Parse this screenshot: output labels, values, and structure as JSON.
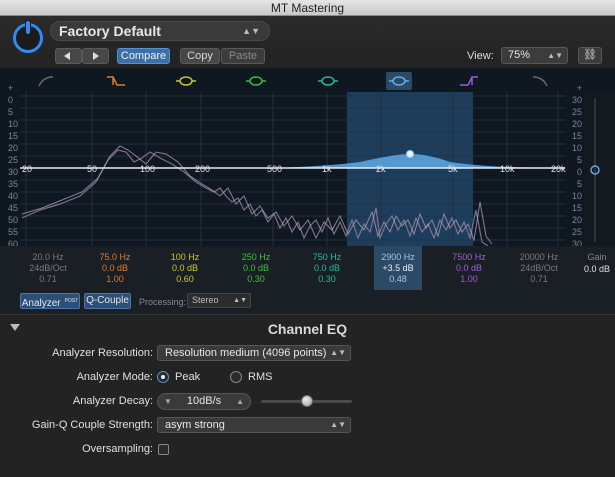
{
  "window": {
    "title": "MT Mastering"
  },
  "header": {
    "preset_name": "Factory Default",
    "compare_label": "Compare",
    "copy_label": "Copy",
    "paste_label": "Paste",
    "view_label": "View:",
    "view_value": "75%"
  },
  "graph": {
    "db_scale_left": [
      "+",
      "0",
      "5",
      "10",
      "15",
      "20",
      "25",
      "30",
      "35",
      "40",
      "45",
      "50",
      "55",
      "60",
      "-"
    ],
    "db_scale_right": [
      "+",
      "30",
      "25",
      "20",
      "15",
      "10",
      "5",
      "0",
      "5",
      "10",
      "15",
      "20",
      "25",
      "30",
      "-"
    ],
    "freq_labels": [
      "20",
      "50",
      "100",
      "200",
      "500",
      "1k",
      "2k",
      "5k",
      "10k",
      "20k"
    ],
    "gain_label": "Gain",
    "gain_value": "0.0 dB"
  },
  "bands": [
    {
      "freq": "20.0 Hz",
      "gain": "24dB/Oct",
      "q": "0.71",
      "color": "#7a7a7a"
    },
    {
      "freq": "75.0 Hz",
      "gain": "0.0 dB",
      "q": "1.00",
      "color": "#e07a2a"
    },
    {
      "freq": "100 Hz",
      "gain": "0.0 dB",
      "q": "0.60",
      "color": "#c9c92a"
    },
    {
      "freq": "250 Hz",
      "gain": "0.0 dB",
      "q": "0.30",
      "color": "#3fbf3f"
    },
    {
      "freq": "750 Hz",
      "gain": "0.0 dB",
      "q": "0.30",
      "color": "#2ab89e"
    },
    {
      "freq": "2900 Hz",
      "gain": "+3.5 dB",
      "q": "0.48",
      "color": "#5fb0f0"
    },
    {
      "freq": "7500 Hz",
      "gain": "0.0 dB",
      "q": "1.00",
      "color": "#9b5fd8"
    },
    {
      "freq": "20000 Hz",
      "gain": "24dB/Oct",
      "q": "0.71",
      "color": "#7a7a7a"
    }
  ],
  "analyzer": {
    "analyzer_label": "Analyzer",
    "post_label": "POST",
    "qcouple_label": "Q-Couple",
    "processing_label": "Processing:",
    "processing_value": "Stereo"
  },
  "panel": {
    "title": "Channel EQ",
    "resolution_label": "Analyzer Resolution:",
    "resolution_value": "Resolution medium (4096 points)",
    "mode_label": "Analyzer Mode:",
    "mode_peak": "Peak",
    "mode_rms": "RMS",
    "decay_label": "Analyzer Decay:",
    "decay_value": "10dB/s",
    "decay_level": 0.5,
    "gainq_label": "Gain-Q Couple Strength:",
    "gainq_value": "asym strong",
    "oversampling_label": "Oversampling:"
  }
}
